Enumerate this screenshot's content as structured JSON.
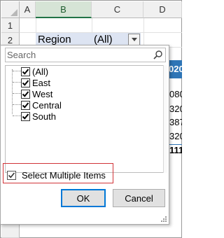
{
  "sheet": {
    "columns": [
      "A",
      "B",
      "C",
      "D"
    ],
    "rows": [
      "1",
      "2"
    ],
    "cells": {
      "b2": "Region",
      "c2": "(All)"
    },
    "d_header_fragment": "020",
    "d_values": [
      "080",
      "320",
      "387",
      "320"
    ],
    "d_total": "111"
  },
  "filter_panel": {
    "search_placeholder": "Search",
    "items": [
      {
        "label": "(All)",
        "checked": true
      },
      {
        "label": "East",
        "checked": true
      },
      {
        "label": "West",
        "checked": true
      },
      {
        "label": "Central",
        "checked": true
      },
      {
        "label": "South",
        "checked": true
      }
    ],
    "select_multiple": {
      "label": "Select Multiple Items",
      "checked": true
    },
    "ok_label": "OK",
    "cancel_label": "Cancel"
  },
  "colors": {
    "excel_green": "#217346",
    "pivot_blue": "#2e75b6",
    "highlight_red": "#d13438",
    "button_focus": "#0078d7"
  },
  "icons": [
    "search-icon",
    "filter-dropdown-icon",
    "check-icon",
    "resize-grip-icon"
  ]
}
